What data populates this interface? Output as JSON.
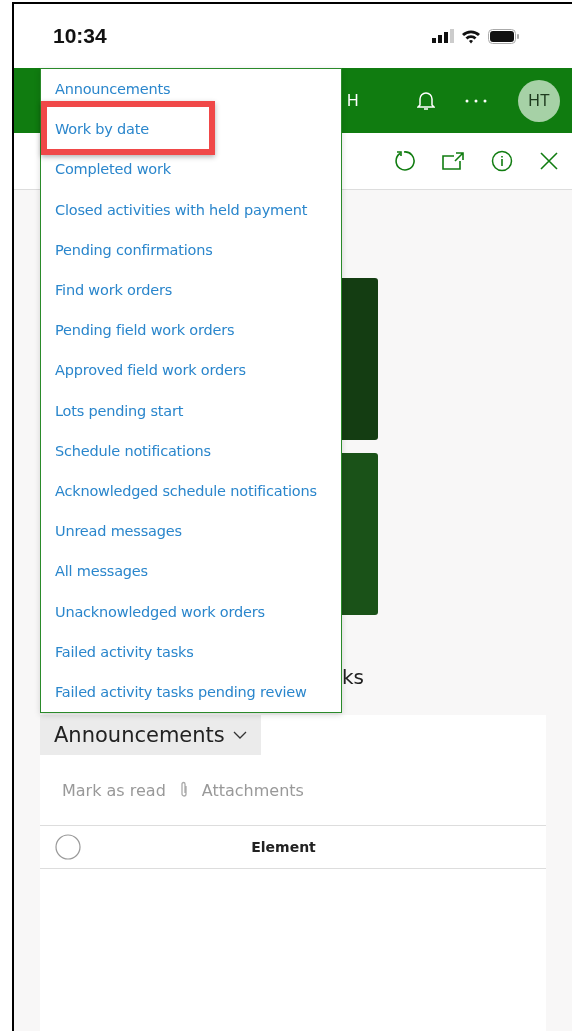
{
  "status_bar": {
    "time": "10:34"
  },
  "header": {
    "partial_text": "H",
    "avatar": "HT"
  },
  "section_heading_partial": "ks",
  "announcements": {
    "title": "Announcements",
    "actions": [
      "Mark as read",
      "Attachments"
    ],
    "columns": [
      "Element"
    ],
    "select_all_checked": false
  },
  "menu": {
    "items": [
      {
        "label": "Announcements",
        "highlighted": false
      },
      {
        "label": "Work by date",
        "highlighted": true
      },
      {
        "label": "Completed work",
        "highlighted": false
      },
      {
        "label": "Closed activities with held payment",
        "highlighted": false
      },
      {
        "label": "Pending confirmations",
        "highlighted": false
      },
      {
        "label": "Find work orders",
        "highlighted": false
      },
      {
        "label": "Pending field work orders",
        "highlighted": false
      },
      {
        "label": "Approved field work orders",
        "highlighted": false
      },
      {
        "label": "Lots pending start",
        "highlighted": false
      },
      {
        "label": "Schedule notifications",
        "highlighted": false
      },
      {
        "label": "Acknowledged schedule notifications",
        "highlighted": false
      },
      {
        "label": "Unread messages",
        "highlighted": false
      },
      {
        "label": "All messages",
        "highlighted": false
      },
      {
        "label": "Unacknowledged work orders",
        "highlighted": false
      },
      {
        "label": "Failed activity tasks",
        "highlighted": false
      },
      {
        "label": "Failed activity tasks pending review",
        "highlighted": false
      }
    ]
  }
}
